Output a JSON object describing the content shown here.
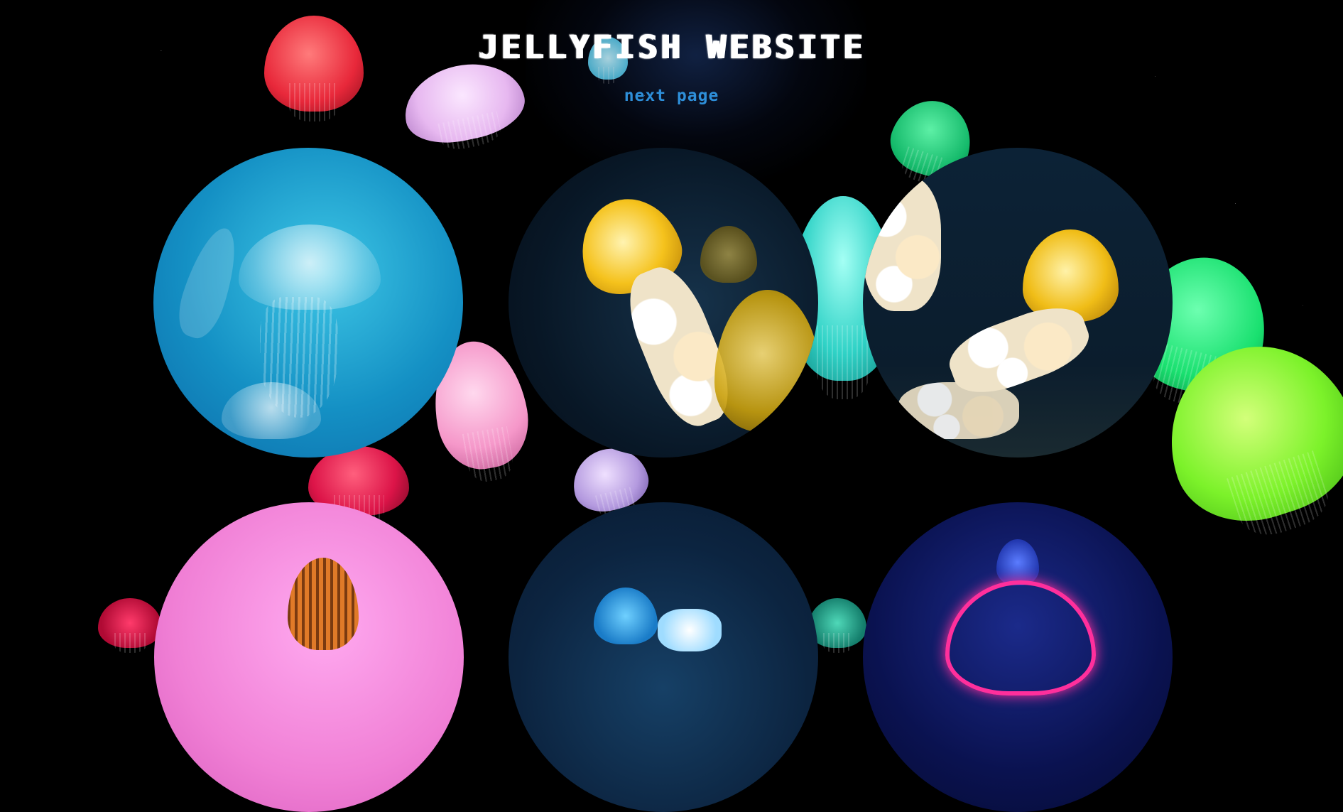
{
  "page": {
    "title": "JELLYFISH WEBSITE",
    "next_link": "next page"
  },
  "colors": {
    "background": "#000000",
    "title": "#ffffff",
    "link": "#2e8fd9"
  },
  "gallery": [
    {
      "subject": "moon jellyfish on blue water",
      "tone": "#1a9fce"
    },
    {
      "subject": "pacific sea nettle yellow",
      "tone": "#0b1c2e"
    },
    {
      "subject": "sea nettles with white frills",
      "tone": "#0a1a2a"
    },
    {
      "subject": "orange striped jellyfish on pink",
      "tone": "#f07fd5"
    },
    {
      "subject": "blue jellyfish in deep water",
      "tone": "#0c2440"
    },
    {
      "subject": "magenta glowing jellyfish",
      "tone": "#0a1250"
    }
  ]
}
